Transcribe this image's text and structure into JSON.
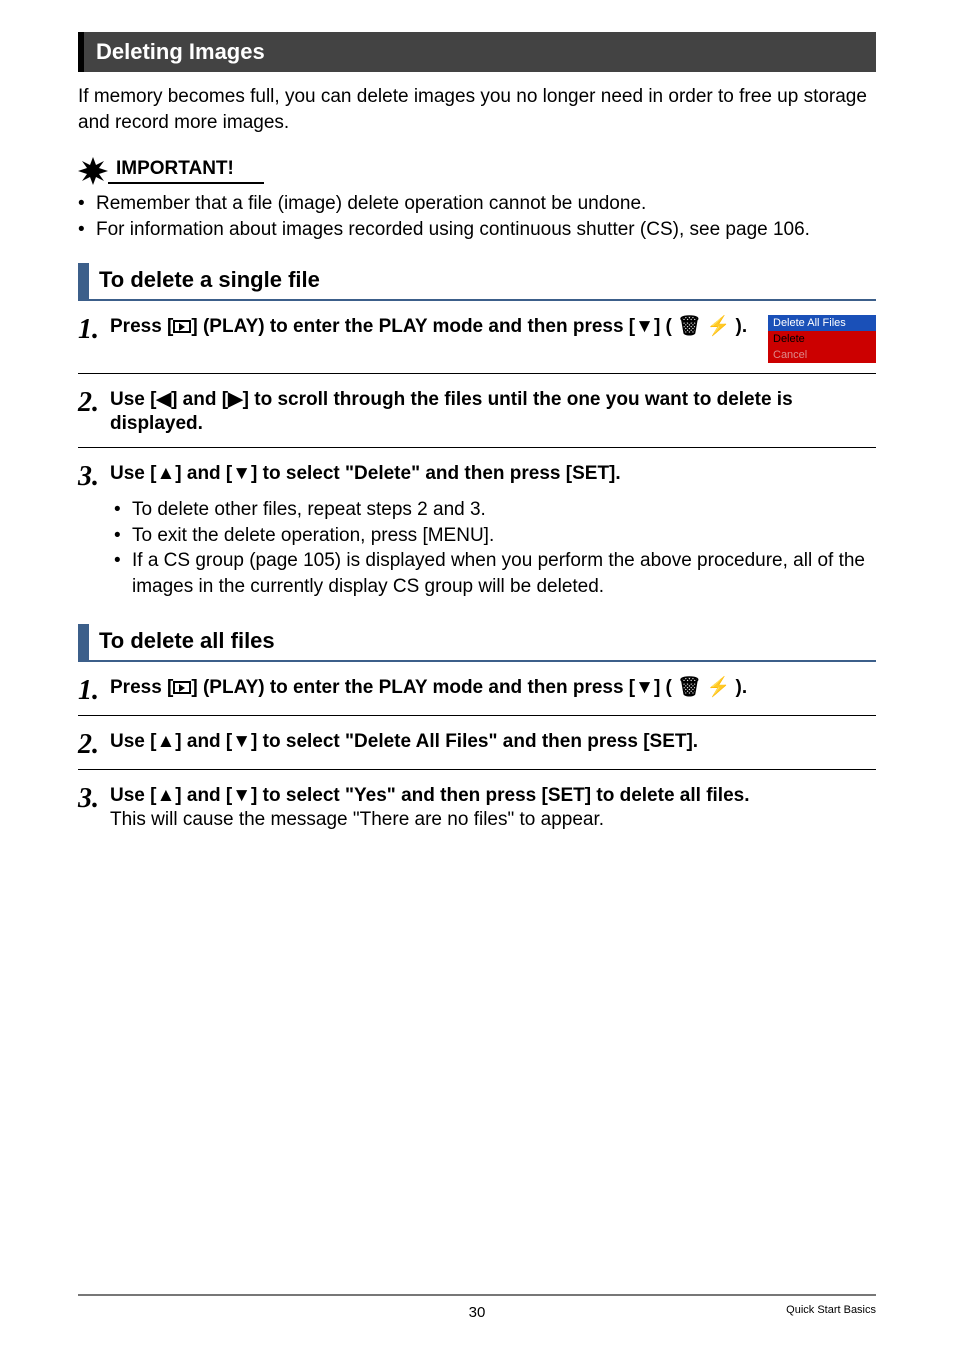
{
  "section": {
    "title": "Deleting Images"
  },
  "intro": "If memory becomes full, you can delete images you no longer need in order to free up storage and record more images.",
  "important": {
    "label": "IMPORTANT!",
    "items": [
      "Remember that a file (image) delete operation cannot be undone.",
      "For information about images recorded using continuous shutter (CS), see page 106."
    ]
  },
  "sub1": {
    "title": "To delete a single file",
    "step1_a": "Press [",
    "step1_b": "] (PLAY) to enter the PLAY mode and then press [▼] ( 🗑 ⚡ ).",
    "step2": "Use [◀] and [▶] to scroll through the files until the one you want to delete is displayed.",
    "step3": "Use [▲] and [▼] to select \"Delete\" and then press [SET].",
    "step3_bullets": [
      "To delete other files, repeat steps 2 and 3.",
      "To exit the delete operation, press [MENU].",
      "If a CS group (page 105) is displayed when you perform the above procedure, all of the images in the currently display CS group will be deleted."
    ]
  },
  "thumb": {
    "r1": "Delete All Files",
    "r2": "Delete",
    "r3": "Cancel"
  },
  "sub2": {
    "title": "To delete all files",
    "step1_a": "Press [",
    "step1_b": "] (PLAY) to enter the PLAY mode and then press [▼] ( 🗑 ⚡ ).",
    "step2": "Use [▲] and [▼] to select \"Delete All Files\" and then press [SET].",
    "step3": "Use [▲] and [▼] to select \"Yes\" and then press [SET] to delete all files.",
    "step3_note": "This will cause the message \"There are no files\" to appear."
  },
  "footer": {
    "page": "30",
    "label": "Quick Start Basics"
  }
}
